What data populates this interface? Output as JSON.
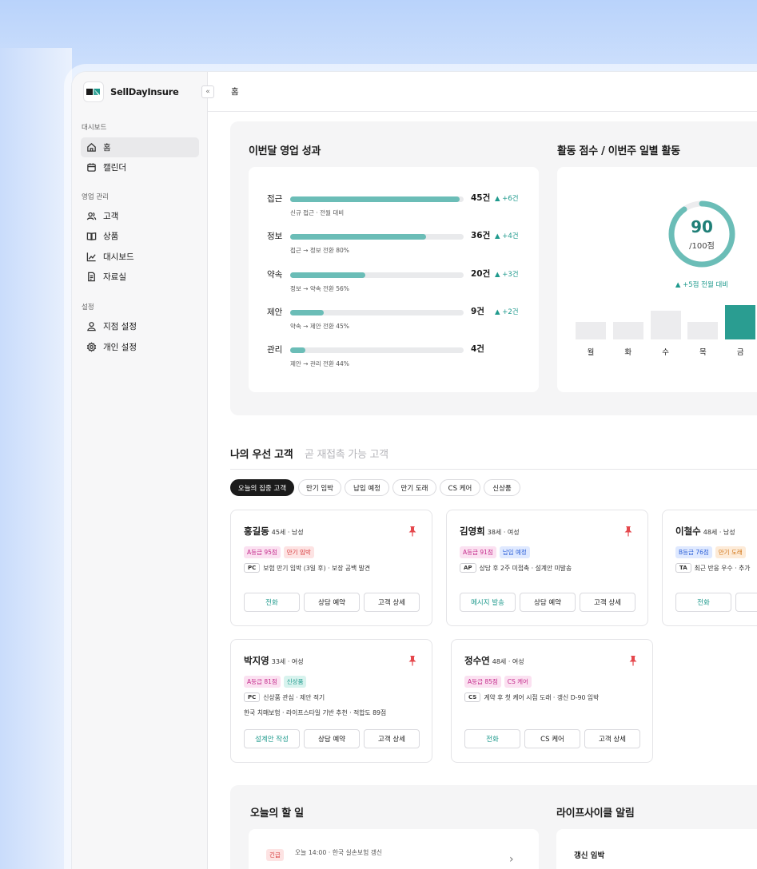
{
  "sidebar": {
    "brand": "SellDayInsure",
    "collapse_icon": "«",
    "sections": [
      {
        "label": "대시보드",
        "items": [
          {
            "label": "홈",
            "icon": "home-icon"
          },
          {
            "label": "캘린더",
            "icon": "calendar-icon"
          }
        ]
      },
      {
        "label": "영업 관리",
        "items": [
          {
            "label": "고객",
            "icon": "users-icon"
          },
          {
            "label": "상품",
            "icon": "book-icon"
          },
          {
            "label": "대시보드",
            "icon": "chart-line-icon"
          },
          {
            "label": "자료실",
            "icon": "document-icon"
          }
        ]
      },
      {
        "label": "설정",
        "items": [
          {
            "label": "지점 설정",
            "icon": "user-icon"
          },
          {
            "label": "개인 설정",
            "icon": "gear-icon"
          }
        ]
      }
    ]
  },
  "topbar": {
    "crumb": "홈"
  },
  "performance": {
    "title": "이번달 영업 성과",
    "rows": [
      {
        "label": "접근",
        "count": "45건",
        "value": 45,
        "delta": "+6건",
        "sub": "신규 접근 · 전월 대비"
      },
      {
        "label": "정보",
        "count": "36건",
        "value": 36,
        "delta": "+4건",
        "sub": "접근 → 정보 전환 80%"
      },
      {
        "label": "약속",
        "count": "20건",
        "value": 20,
        "delta": "+3건",
        "sub": "정보 → 약속 전환 56%"
      },
      {
        "label": "제안",
        "count": "9건",
        "value": 9,
        "delta": "+2건",
        "sub": "약속 → 제안 전환 45%"
      },
      {
        "label": "관리",
        "count": "4건",
        "value": 4,
        "delta": "",
        "sub": "제안 → 관리 전환 44%"
      }
    ],
    "max": 46
  },
  "activity": {
    "title": "활동 점수 / 이번주 일별 활동",
    "score": "90",
    "score_unit": "/100점",
    "score_value": 90,
    "delta": "+5점 전월 대비",
    "days": [
      {
        "label": "월",
        "level": 0.38,
        "highlight": false
      },
      {
        "label": "화",
        "level": 0.38,
        "highlight": false
      },
      {
        "label": "수",
        "level": 0.62,
        "highlight": false
      },
      {
        "label": "목",
        "level": 0.38,
        "highlight": false
      },
      {
        "label": "금",
        "level": 0.74,
        "highlight": true
      }
    ]
  },
  "customers": {
    "tab_active": "나의 우선 고객",
    "tab_inactive": "곧 재접촉 가능 고객",
    "chips": [
      "오늘의 집중 고객",
      "만기 임박",
      "납입 예정",
      "만기 도래",
      "CS 케어",
      "신상품"
    ],
    "cards": [
      {
        "name": "홍길동",
        "meta": "45세 · 남성",
        "tags": [
          {
            "text": "A등급 95점",
            "color": "pink"
          },
          {
            "text": "만기 임박",
            "color": "red"
          }
        ],
        "code": "PC",
        "desc": "보험 만기 임박 (3일 후) · 보장 공백 발견",
        "extra": "",
        "buttons": [
          "전화",
          "상담 예약",
          "고객 상세"
        ]
      },
      {
        "name": "김영희",
        "meta": "38세 · 여성",
        "tags": [
          {
            "text": "A등급 91점",
            "color": "pink"
          },
          {
            "text": "납입 예정",
            "color": "blue"
          }
        ],
        "code": "AP",
        "desc": "상담 후 2주 미접촉 · 설계안 미발송",
        "extra": "",
        "buttons": [
          "메시지 발송",
          "상담 예약",
          "고객 상세"
        ]
      },
      {
        "name": "이철수",
        "meta": "48세 · 남성",
        "tags": [
          {
            "text": "B등급 76점",
            "color": "blue"
          },
          {
            "text": "만기 도래",
            "color": "orange"
          }
        ],
        "code": "TA",
        "desc": "최근 반응 우수 · 추가",
        "extra": "",
        "buttons": [
          "전화",
          ""
        ]
      },
      {
        "name": "박지영",
        "meta": "33세 · 여성",
        "tags": [
          {
            "text": "A등급 81점",
            "color": "pink"
          },
          {
            "text": "신상품",
            "color": "teal"
          }
        ],
        "code": "PC",
        "desc": "신상품 관심 · 제안 적기",
        "extra": "한국 치매보험 · 라이프스타일 기반 추천 · 적합도 89점",
        "buttons": [
          "설계안 작성",
          "상담 예약",
          "고객 상세"
        ]
      },
      {
        "name": "정수연",
        "meta": "48세 · 여성",
        "tags": [
          {
            "text": "A등급 85점",
            "color": "pink"
          },
          {
            "text": "CS 케어",
            "color": "pink"
          }
        ],
        "code": "CS",
        "desc": "계약 후 첫 케어 시점 도래 · 갱신 D-90 임박",
        "extra": "",
        "buttons": [
          "전화",
          "CS 케어",
          "고객 상세"
        ]
      }
    ]
  },
  "todo": {
    "title": "오늘의 할 일",
    "badge": "긴급",
    "item": "오늘 14:00 · 한국 실손보험 갱신",
    "chevron": "›"
  },
  "lifecycle": {
    "title": "라이프사이클 알림",
    "item": "갱신 임박"
  },
  "colors": {
    "accent": "#1f9a8d",
    "bar": "#6bbdb7",
    "pin": "#e5484d"
  }
}
